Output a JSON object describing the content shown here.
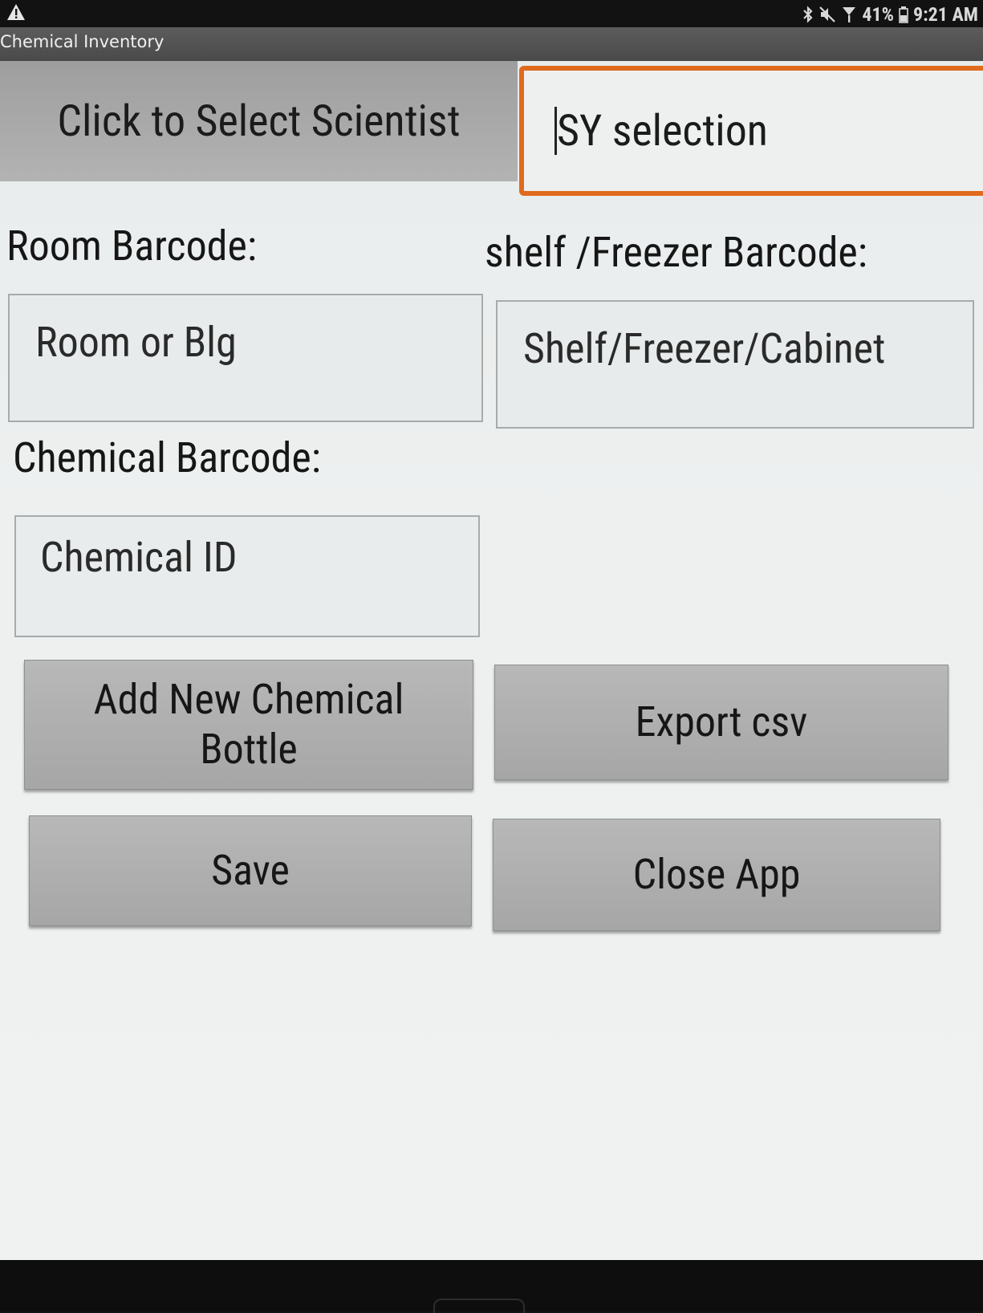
{
  "status_bar": {
    "warning_icon": "warning-triangle-icon",
    "battery": "41%",
    "time": "9:21 AM",
    "icons": [
      "bluetooth-icon",
      "mute-icon",
      "signal-icon",
      "battery-icon"
    ]
  },
  "app": {
    "title": "Chemical Inventory"
  },
  "scientist": {
    "button_label": "Click to Select Scientist",
    "selection_value": "SY selection"
  },
  "room": {
    "label": "Room Barcode:",
    "placeholder": "Room or Blg"
  },
  "shelf": {
    "label": "shelf /Freezer Barcode:",
    "placeholder": "Shelf/Freezer/Cabinet"
  },
  "chemical": {
    "label": "Chemical  Barcode:",
    "placeholder": "Chemical ID"
  },
  "buttons": {
    "add_new": "Add New Chemical Bottle",
    "export": "Export csv",
    "save": "Save",
    "close": "Close App"
  },
  "colors": {
    "focus_border": "#e06a1e",
    "button_bg": "#adadad"
  }
}
